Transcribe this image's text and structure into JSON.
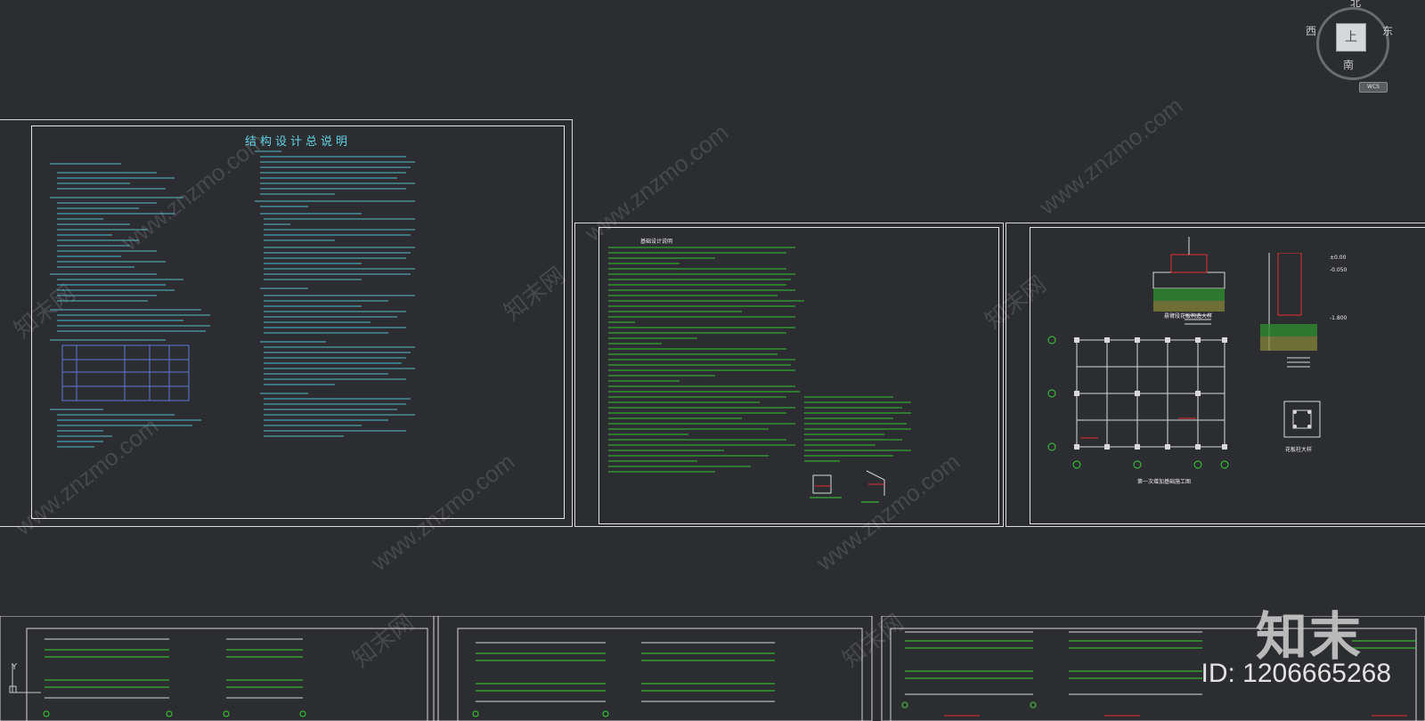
{
  "viewcube": {
    "top_label": "上",
    "north": "北",
    "south": "南",
    "west": "西",
    "east": "东",
    "wcs_label": "WCS"
  },
  "sheet1": {
    "title": "结构设计总说明"
  },
  "sheet2": {
    "title": "基础设计说明"
  },
  "sheet3": {
    "plan_title": "第一次增加基础施工图",
    "detail1_title": "悬臂段花板构造大样",
    "detail2_title": "花板柱大样",
    "elev1": "±0.00",
    "elev2": "-0.050",
    "elev3": "-1.800"
  },
  "watermark": {
    "brand": "知末",
    "id": "ID: 1206665268",
    "site": "www.znzmo.com",
    "site_cn": "知末网"
  },
  "ucs": {
    "y_label": "Y"
  },
  "colors": {
    "background": "#2c2d30",
    "cad_green": "#37d437",
    "cad_cyan": "#5fd3e6",
    "cad_red": "#e03030",
    "frame": "#d8d8d8"
  }
}
